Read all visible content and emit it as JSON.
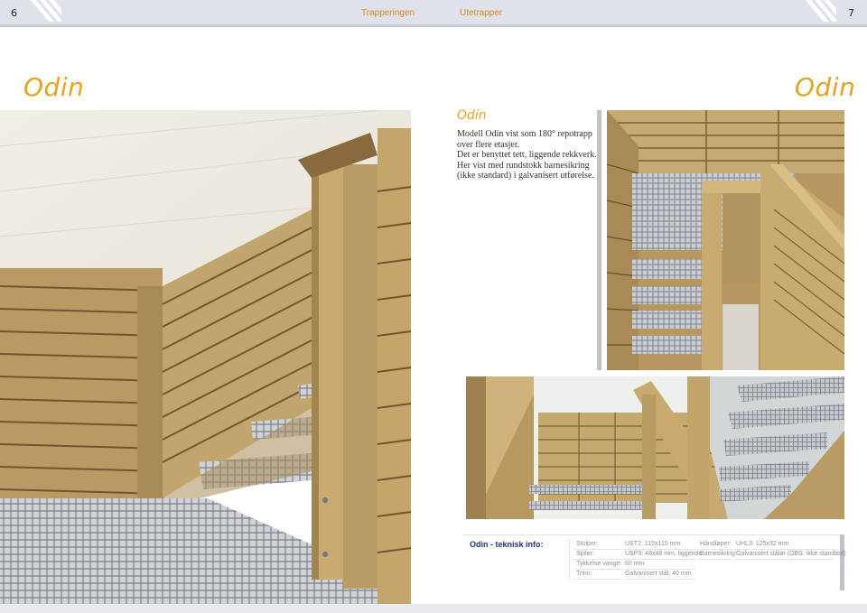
{
  "header": {
    "page_left": "6",
    "page_right": "7",
    "link_1": "Trapperingen",
    "link_2": "Utetrapper"
  },
  "titles": {
    "left": "Odin",
    "right": "Odin"
  },
  "description": {
    "title": "Odin",
    "lines": [
      "Modell Odin vist som 180° repotrapp",
      "over flere etasjer.",
      "Det er benyttet tett, liggende rekkverk.",
      "Her vist med rundstokk barnesikring",
      "(ikke standard) i galvanisert utførelse."
    ]
  },
  "photos": {
    "main": "stair-landing-photo",
    "top_right": "stairwell-grating-photo",
    "bottom_right": "outdoor-stair-photo"
  },
  "tech": {
    "label": "Odin - teknisk info:",
    "col1_labels": [
      "Stolper:",
      "Spiler:",
      "Tykkelse vange:",
      "Trinn:"
    ],
    "col1_values": [
      "UST2: 115x115 mm",
      "USP3: 48x48 mm, liggende",
      "60 mm",
      "Galvanisert stål, 40 mm"
    ],
    "col2_labels": [
      "Håndløper:",
      "Barnesikring:"
    ],
    "col2_values": [
      "UHL3: 125x32 mm",
      "Galvanisert stålør (OBS: ikke standard)"
    ]
  },
  "colors": {
    "accent": "#e8a21f",
    "header_bg": "#dfe2ea",
    "tech_label": "#1f3a78"
  }
}
